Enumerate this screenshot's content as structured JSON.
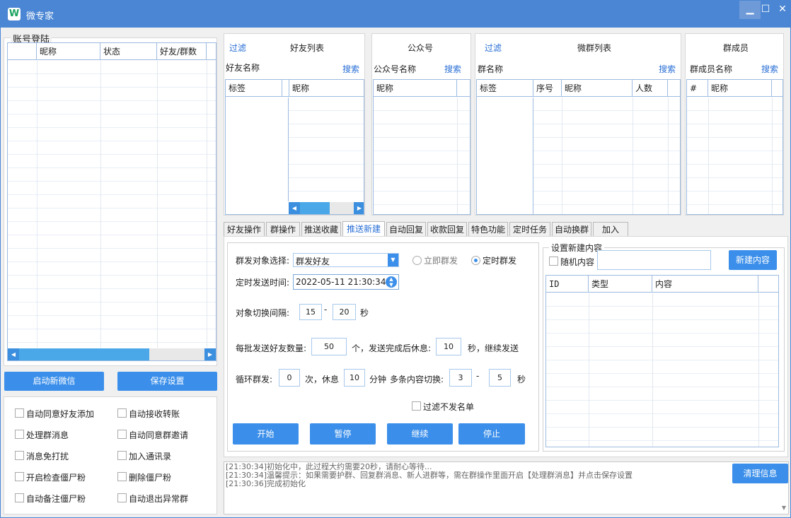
{
  "app": {
    "logo": "W",
    "title": "微专家"
  },
  "window": {
    "min": "▁",
    "max": "☐",
    "close": "✕"
  },
  "account": {
    "legend": "账号登陆",
    "columns": [
      "昵称",
      "状态",
      "好友/群数"
    ],
    "start_btn": "启动新微信",
    "save_btn": "保存设置"
  },
  "options": {
    "left": [
      "自动同意好友添加",
      "处理群消息",
      "消息免打扰",
      "开启检查僵尸粉",
      "自动备注僵尸粉"
    ],
    "right": [
      "自动接收转账",
      "自动同意群邀请",
      "加入通讯录",
      "删除僵尸粉",
      "自动退出异常群"
    ]
  },
  "friends": {
    "filter": "过滤",
    "title": "好友列表",
    "name_label": "好友名称",
    "search": "搜索",
    "col_tag": "标签",
    "col_nick": "昵称"
  },
  "mp": {
    "title": "公众号",
    "name_label": "公众号名称",
    "search": "搜索",
    "col_nick": "昵称"
  },
  "groups": {
    "filter": "过滤",
    "title": "微群列表",
    "name_label": "群名称",
    "search": "搜索",
    "col_tag": "标签",
    "col_no": "序号",
    "col_nick": "昵称",
    "col_count": "人数"
  },
  "members": {
    "title": "群成员",
    "name_label": "群成员名称",
    "search": "搜索",
    "col_hash": "#",
    "col_nick": "昵称"
  },
  "tabs": [
    "好友操作",
    "群操作",
    "推送收藏",
    "推送新建",
    "自动回复",
    "收款回复",
    "特色功能",
    "定时任务",
    "自动换群",
    "加入"
  ],
  "active_tab": "推送新建",
  "push": {
    "target_label": "群发对象选择:",
    "target_value": "群发好友",
    "now_label": "立即群发",
    "timed_label": "定时群发",
    "time_label": "定时发送时间:",
    "time_value": "2022-05-11 21:30:34",
    "switch_label": "对象切换间隔:",
    "switch_from": "15",
    "switch_dash": "-",
    "switch_to": "20",
    "sec": "秒",
    "batch_label": "每批发送好友数量:",
    "batch_value": "50",
    "batch_unit": "个，发送完成后休息:",
    "rest_value": "10",
    "rest_unit": "秒，继续发送",
    "loop_label": "循环群发:",
    "loop_value": "0",
    "loop_unit": "次，休息",
    "loop_rest": "10",
    "loop_rest_unit": "分钟",
    "multi_label": "多条内容切换:",
    "multi_from": "3",
    "multi_dash": "-",
    "multi_to": "5",
    "multi_sec": "秒",
    "skip_label": "过滤不发名单",
    "btn_start": "开始",
    "btn_pause": "暂停",
    "btn_resume": "继续",
    "btn_stop": "停止"
  },
  "content": {
    "legend": "设置新建内容",
    "random_label": "随机内容",
    "new_btn": "新建内容",
    "col_id": "ID",
    "col_type": "类型",
    "col_content": "内容"
  },
  "log": {
    "lines": [
      "[21:30:34]初始化中，此过程大约需要20秒，请耐心等待...",
      "[21:30:34]温馨提示：如果需要护群、回复群消息、新人进群等，需在群操作里面开启【处理群消息】并点击保存设置",
      "[21:30:36]完成初始化"
    ],
    "clear_btn": "清理信息"
  },
  "colors": {
    "accent": "#3b8fea",
    "titlebar": "#4a86d4",
    "link": "#2a6fd6"
  }
}
